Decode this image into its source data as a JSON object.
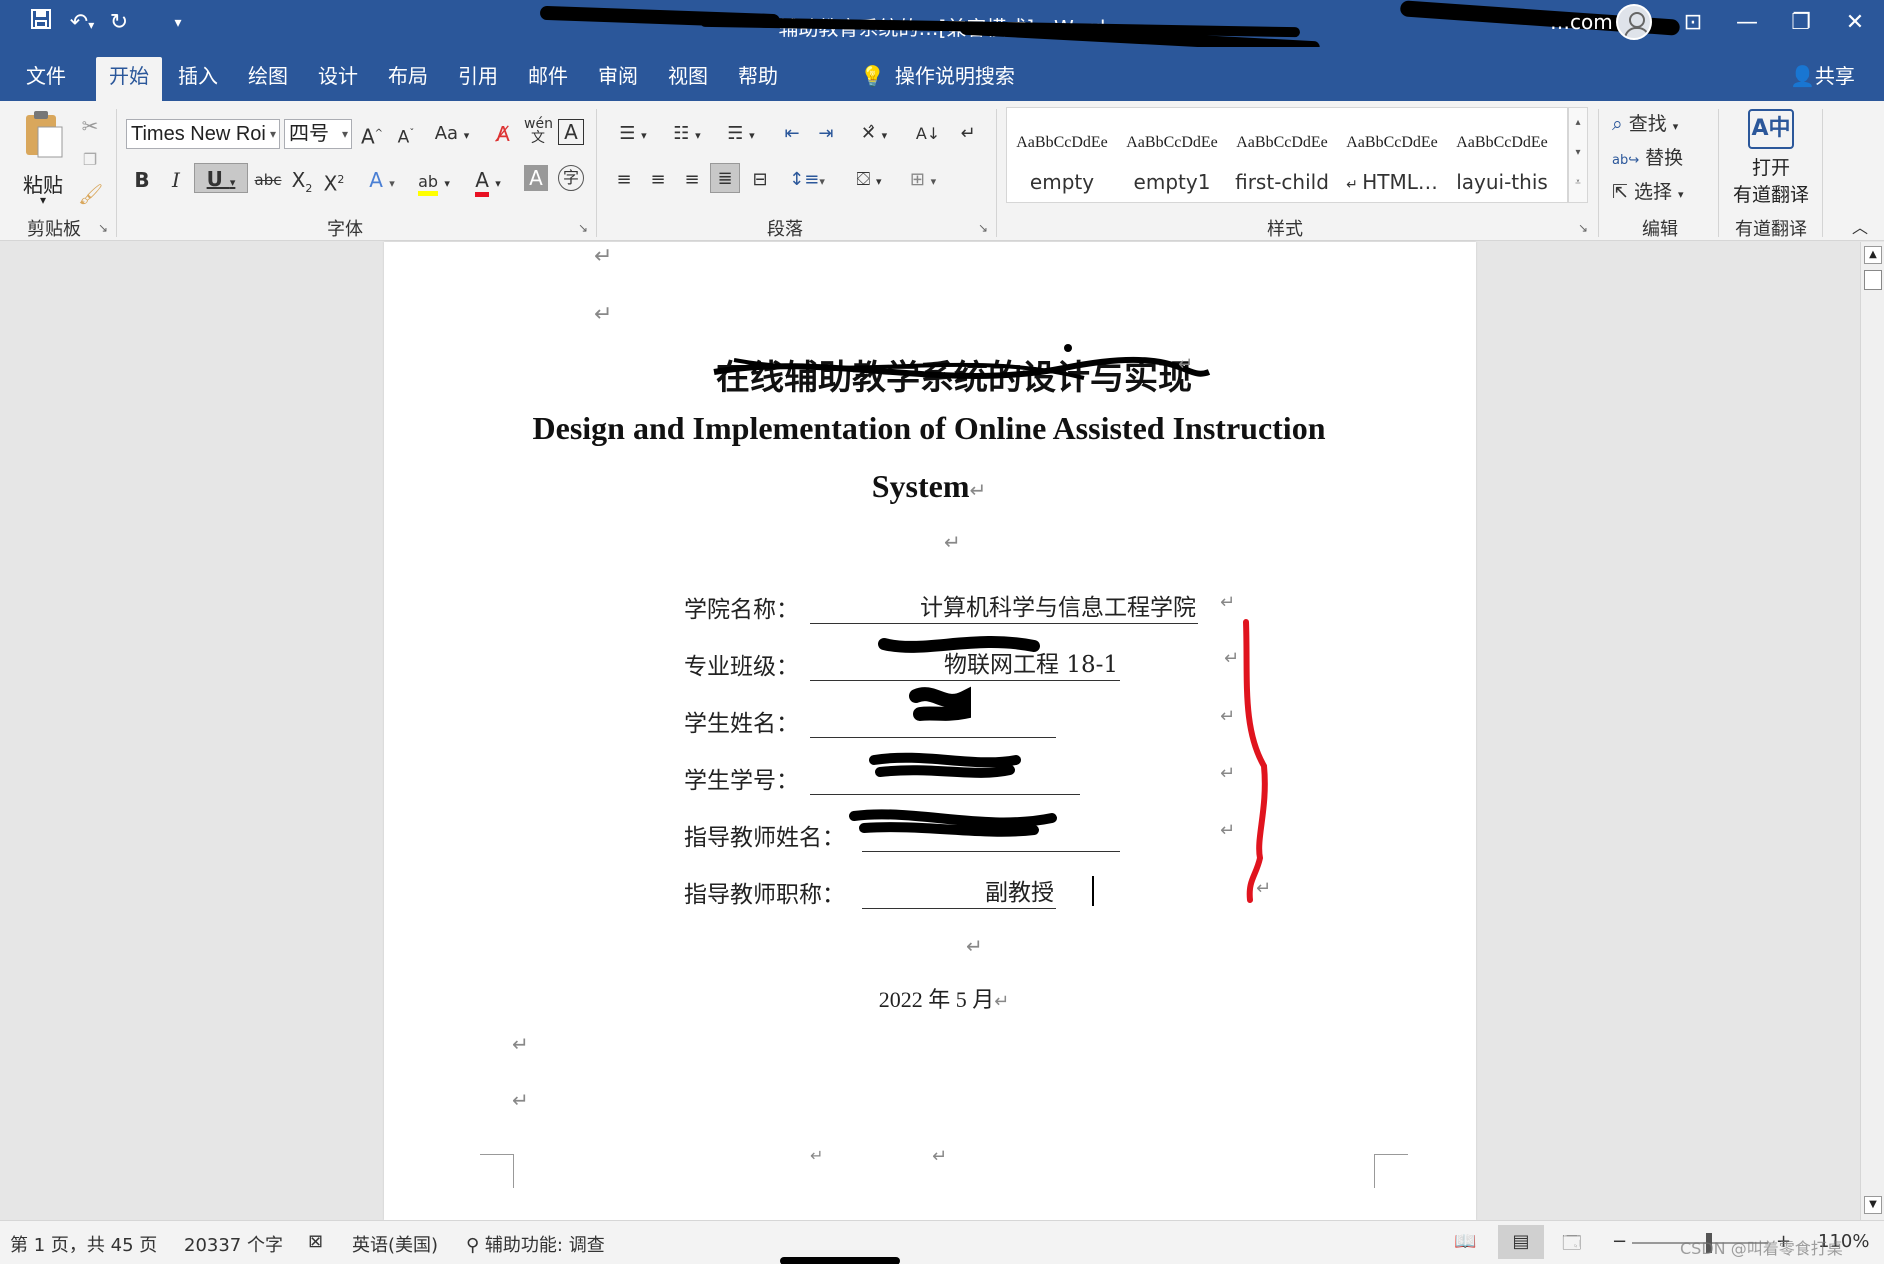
{
  "window": {
    "title": "辅助教育系统的…[兼容模式] - Word",
    "account": "…com",
    "qat": {
      "save_icon": "save-icon",
      "undo_icon": "undo-icon",
      "redo_icon": "redo-icon",
      "customize": "▾"
    }
  },
  "tabs": [
    "文件",
    "开始",
    "插入",
    "绘图",
    "设计",
    "布局",
    "引用",
    "邮件",
    "审阅",
    "视图",
    "帮助"
  ],
  "active_tab": "开始",
  "tell_me": "操作说明搜索",
  "share": "共享",
  "ribbon": {
    "clipboard": {
      "label": "剪贴板",
      "paste": "粘贴"
    },
    "font": {
      "label": "字体",
      "font_name": "Times New Roi",
      "font_size": "四号"
    },
    "paragraph": {
      "label": "段落"
    },
    "styles": {
      "label": "样式",
      "preview": "AaBbCcDdEe",
      "items": [
        "empty",
        "empty1",
        "first-child",
        "HTML…",
        "layui-this"
      ]
    },
    "editing": {
      "label": "编辑",
      "find": "查找",
      "replace": "替换",
      "select": "选择"
    },
    "youdao": {
      "label": "有道翻译",
      "open": "打开",
      "translate": "有道翻译"
    }
  },
  "document": {
    "cn_title": "在线辅助教学系统的设计与实现",
    "en_title_line1": "Design and Implementation of Online Assisted Instruction",
    "en_title_line2": "System",
    "fields": [
      {
        "label": "学院名称：",
        "value": "计算机科学与信息工程学院"
      },
      {
        "label": "专业班级：",
        "value": "物联网工程 18-1"
      },
      {
        "label": "学生姓名：",
        "value": ""
      },
      {
        "label": "学生学号：",
        "value": ""
      },
      {
        "label": "指导教师姓名：",
        "value": ""
      },
      {
        "label": "指导教师职称：",
        "value": "副教授"
      }
    ],
    "date": "2022 年  5  月",
    "paragraph_mark": "↵",
    "annotation_color": "#e0141e"
  },
  "status": {
    "page": "第 1 页，共 45 页",
    "words": "20337 个字",
    "language": "英语(美国)",
    "accessibility": "辅助功能: 调查",
    "zoom": "110%",
    "watermark": "CSDN @叫着零食打桌"
  },
  "colors": {
    "word_blue": "#2b579a",
    "ribbon_bg": "#f3f3f3"
  }
}
